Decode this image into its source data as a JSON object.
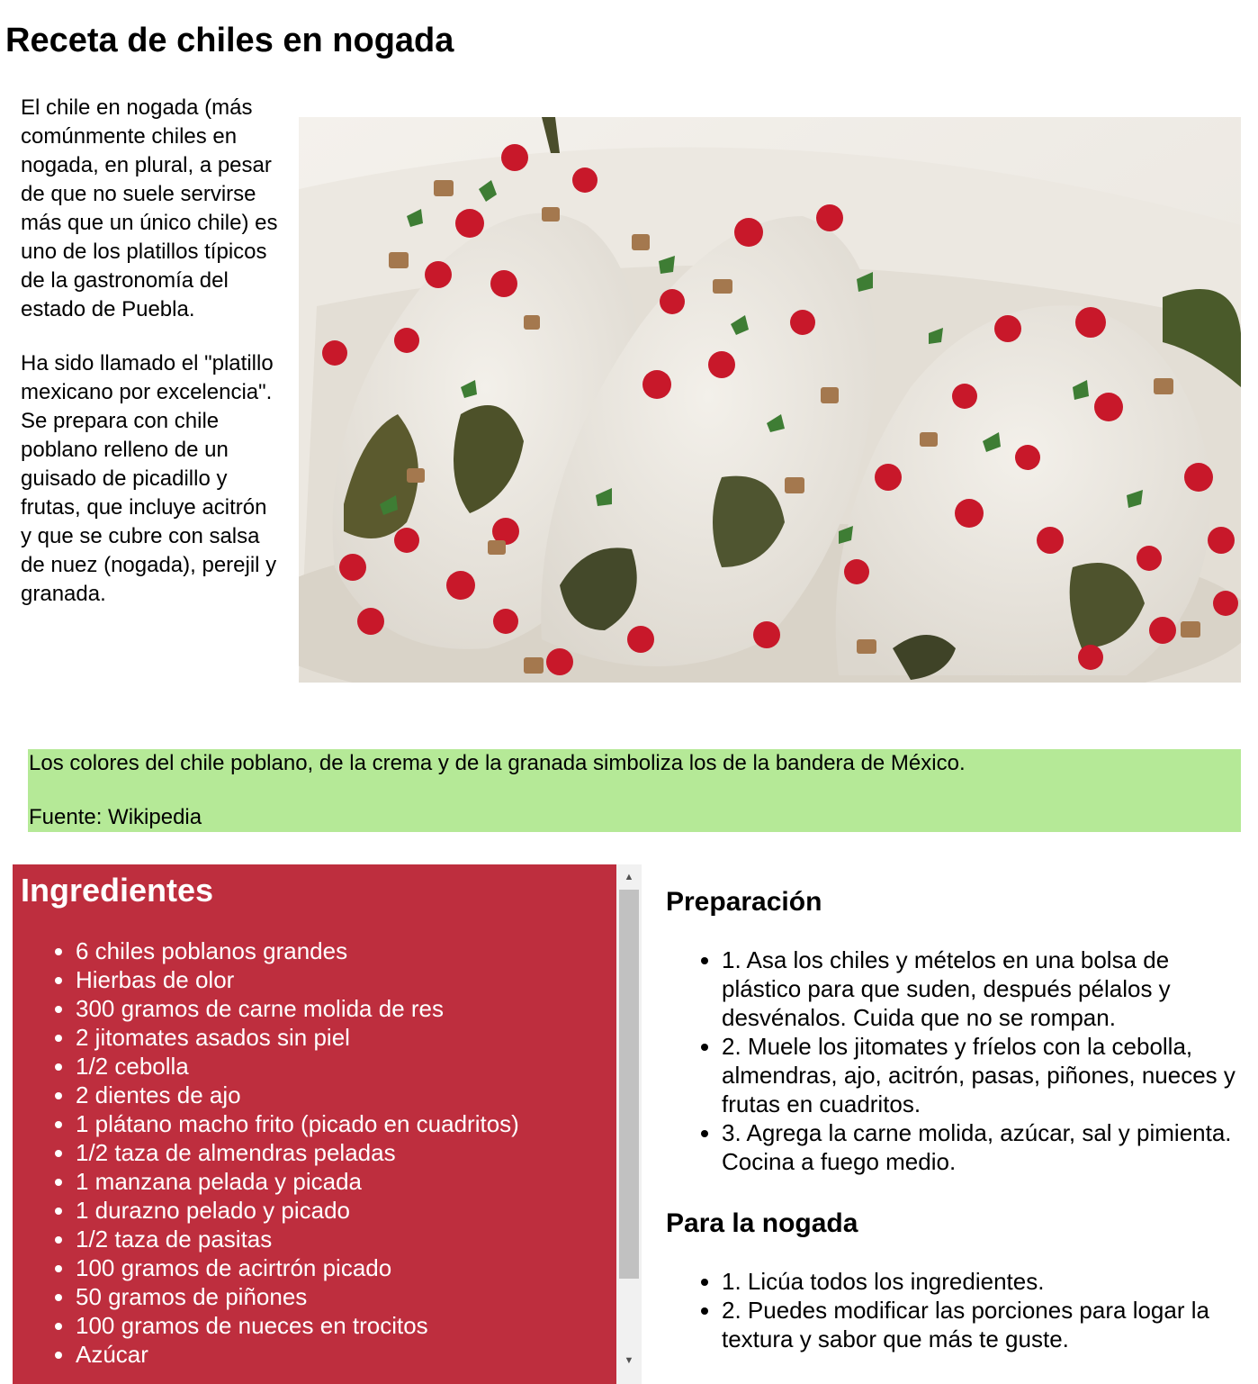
{
  "page": {
    "title": "Receta de chiles en nogada"
  },
  "intro": {
    "paragraph_1": "El chile en nogada (más comúnmente chiles en nogada, en plural, a pesar de que no suele servirse más que un único chile) es uno de los platillos típicos de la gastronomía del estado de Puebla.",
    "paragraph_2": "Ha sido llamado el \"platillo mexicano por excelencia\". Se prepara con chile poblano relleno de un guisado de picadillo y frutas, que incluye acitrón y que se cubre con salsa de nuez (nogada), perejil y granada."
  },
  "note": {
    "text": "Los colores del chile poblano, de la crema y de la granada simboliza los de la bandera de México.",
    "source": "Fuente: Wikipedia"
  },
  "ingredients": {
    "title": "Ingredientes",
    "items": [
      "6 chiles poblanos grandes",
      "Hierbas de olor",
      "300 gramos de carne molida de res",
      "2 jitomates asados sin piel",
      "1/2 cebolla",
      "2 dientes de ajo",
      "1 plátano macho frito (picado en cuadritos)",
      "1/2 taza de almendras peladas",
      "1 manzana pelada y picada",
      "1 durazno pelado y picado",
      "1/2 taza de pasitas",
      "100 gramos de acirtrón picado",
      "50 gramos de piñones",
      "100 gramos de nueces en trocitos",
      "Azúcar"
    ]
  },
  "preparation": {
    "title": "Preparación",
    "steps": [
      "1. Asa los chiles y mételos en una bolsa de plástico para que suden, después pélalos y desvénalos. Cuida que no se rompan.",
      "2. Muele los jitomates y fríelos con la cebolla, almendras, ajo, acitrón, pasas, piñones, nueces y frutas en cuadritos.",
      "3. Agrega la carne molida, azúcar, sal y pimienta. Cocina a fuego medio."
    ]
  },
  "nogada": {
    "title": "Para la nogada",
    "steps": [
      "1. Licúa todos los ingredientes.",
      "2. Puedes modificar las porciones para logar la textura y sabor que más te guste."
    ]
  },
  "colors": {
    "note_background": "#b5e997",
    "ingredients_background": "#be2e3e",
    "ingredients_text": "#ffffff"
  },
  "icons": {
    "scroll_up": "scroll-up-arrow-icon",
    "scroll_down": "scroll-down-arrow-icon"
  },
  "scroll": {
    "ingredients_list_position": 0
  }
}
